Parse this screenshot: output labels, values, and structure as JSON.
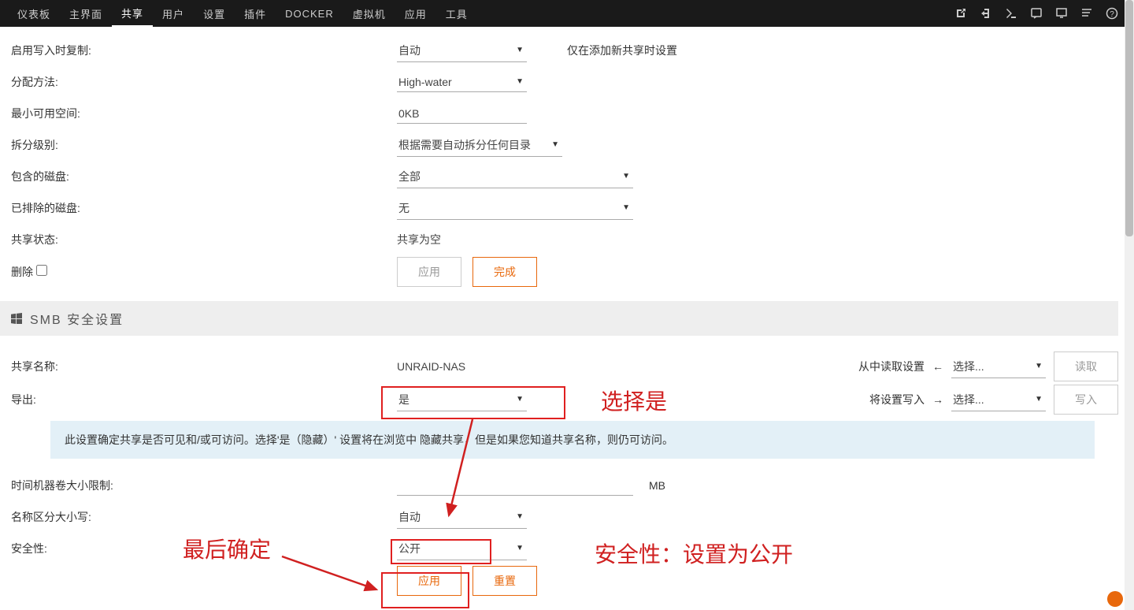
{
  "nav": {
    "items": [
      "仪表板",
      "主界面",
      "共享",
      "用户",
      "设置",
      "插件",
      "DOCKER",
      "虚拟机",
      "应用",
      "工具"
    ],
    "active_index": 2
  },
  "rows": {
    "enable_cow": {
      "label": "启用写入时复制:",
      "value": "自动",
      "hint": "仅在添加新共享时设置"
    },
    "alloc": {
      "label": "分配方法:",
      "value": "High-water"
    },
    "minfree": {
      "label": "最小可用空间:",
      "value": "0KB"
    },
    "split": {
      "label": "拆分级别:",
      "value": "根据需要自动拆分任何目录"
    },
    "included": {
      "label": "包含的磁盘:",
      "value": "全部"
    },
    "excluded": {
      "label": "已排除的磁盘:",
      "value": "无"
    },
    "status": {
      "label": "共享状态:",
      "value": "共享为空"
    },
    "delete": {
      "label": "删除"
    },
    "btn_apply1": "应用",
    "btn_done": "完成"
  },
  "section_smb": "SMB 安全设置",
  "smb": {
    "sharename": {
      "label": "共享名称:",
      "value": "UNRAID-NAS"
    },
    "export": {
      "label": "导出:",
      "value": "是"
    },
    "info": "此设置确定共享是否可见和/或可访问。选择'是（隐藏）' 设置将在浏览中 隐藏共享，但是如果您知道共享名称，则仍可访问。",
    "tmvol": {
      "label": "时间机器卷大小限制:",
      "unit": "MB"
    },
    "casesens": {
      "label": "名称区分大小写:",
      "value": "自动"
    },
    "security": {
      "label": "安全性:",
      "value": "公开"
    },
    "btn_apply2": "应用",
    "btn_reset": "重置"
  },
  "rw": {
    "read_label": "从中读取设置",
    "read_select": "选择...",
    "read_btn": "读取",
    "write_label": "将设置写入",
    "write_select": "选择...",
    "write_btn": "写入"
  },
  "annot": {
    "yes": "选择是",
    "confirm": "最后确定",
    "sec": "安全性：设置为公开"
  }
}
